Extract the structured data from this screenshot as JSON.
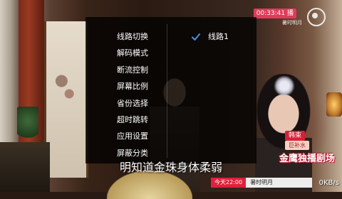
{
  "video": {
    "subtitle": "明知道金珠身体柔弱"
  },
  "channel": {
    "clock": "00:33:41",
    "clock_suffix": "播",
    "sub_label": "暑时明月"
  },
  "settings_menu": {
    "items": [
      {
        "label": "线路切换"
      },
      {
        "label": "解码模式"
      },
      {
        "label": "断流控制"
      },
      {
        "label": "屏幕比例"
      },
      {
        "label": "省份选择"
      },
      {
        "label": "超时跳转"
      },
      {
        "label": "应用设置"
      },
      {
        "label": "屏蔽分类"
      }
    ],
    "options": [
      {
        "label": "线路1",
        "selected": true
      }
    ],
    "check_icon": "checkmark-icon",
    "accent_color": "#4a90e2"
  },
  "promo": {
    "tag1": "韩束",
    "tag2": "巨补水",
    "title": "金鹰独播剧场"
  },
  "schedule": {
    "time": "今天22:00",
    "show": "暑时明月"
  },
  "network": {
    "speed": "0KB/s"
  }
}
